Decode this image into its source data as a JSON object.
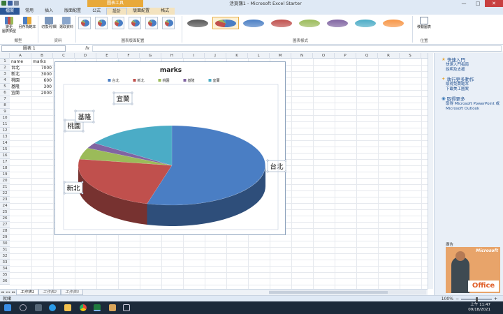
{
  "window": {
    "title": "活頁簿1 - Microsoft Excel Starter",
    "context_tools_label": "圖表工具",
    "controls": [
      "—",
      "□",
      "✕"
    ]
  },
  "tabs": {
    "file": "檔案",
    "home": "常用",
    "insert": "插入",
    "page_layout": "版面配置",
    "formulas": "公式",
    "design": "設計",
    "layout": "版面配置",
    "format": "格式"
  },
  "ribbon": {
    "change_chart_type": "變更\n圖表類型",
    "save_as_template": "另存為範本",
    "switch_row_col": "切換列/欄",
    "select_data": "選取資料",
    "move_chart": "移動圖表",
    "groups": {
      "type": "類型",
      "data": "資料",
      "chart_layouts": "圖表版面配置",
      "chart_styles": "圖表樣式",
      "location": "位置"
    },
    "style_colors": [
      "#555555",
      "#4a7ec4",
      "#4a7ec4",
      "#c0504d",
      "#9bbb59",
      "#8064a2",
      "#4bacc6",
      "#f79646"
    ]
  },
  "formula_bar": {
    "name_box": "圖表 1",
    "fx": "fx",
    "value": ""
  },
  "sheet": {
    "columns": [
      "A",
      "B",
      "C",
      "D",
      "E",
      "F",
      "G",
      "H",
      "I",
      "J",
      "K",
      "L",
      "M",
      "N",
      "O",
      "P",
      "Q",
      "R",
      "S",
      "T"
    ],
    "rows": [
      "1",
      "2",
      "3",
      "4",
      "5",
      "6",
      "7",
      "8",
      "9",
      "10",
      "11",
      "12",
      "13",
      "14",
      "15",
      "16",
      "17",
      "18",
      "19",
      "20",
      "21",
      "22",
      "23",
      "24",
      "25",
      "26",
      "27",
      "28",
      "29",
      "30",
      "31",
      "32",
      "33",
      "34",
      "35",
      "36"
    ],
    "headers": [
      "name",
      "marks"
    ],
    "data": [
      [
        "台北",
        "7000"
      ],
      [
        "新北",
        "3000"
      ],
      [
        "桃園",
        "600"
      ],
      [
        "基隆",
        "300"
      ],
      [
        "宜蘭",
        "2000"
      ]
    ],
    "sheet_tabs": [
      "工作表1",
      "工作表2",
      "工作表3"
    ]
  },
  "chart_data": {
    "type": "pie",
    "title": "marks",
    "categories": [
      "台北",
      "新北",
      "桃園",
      "基隆",
      "宜蘭"
    ],
    "values": [
      7000,
      3000,
      600,
      300,
      2000
    ],
    "colors": [
      "#4a7ec4",
      "#c0504d",
      "#9bbb59",
      "#8064a2",
      "#4bacc6"
    ],
    "legend_position": "top",
    "three_d": true
  },
  "task_pane": {
    "getting_started": "快速入門",
    "gs_links": [
      "快速入門指南",
      "說明及支援"
    ],
    "do_more": "執行更多動作",
    "dm_links": [
      "取得免費範本",
      "下載美工圖案"
    ],
    "get_more": "取得更多",
    "gm_links": [
      "取得 Microsoft PowerPoint 或",
      "Microsoft Outlook"
    ],
    "ad_label": "廣告",
    "ad_brand": "Microsoft",
    "ad_product": "Office"
  },
  "status_bar": {
    "status": "就緒",
    "zoom": "100%"
  },
  "taskbar": {
    "time": "上午 11:47",
    "date": "09/18/2021"
  }
}
